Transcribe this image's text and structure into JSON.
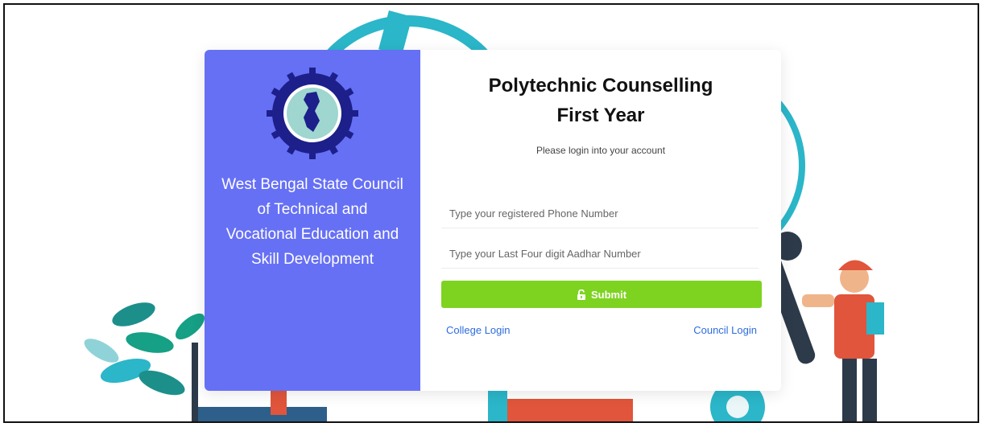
{
  "brand": {
    "council_name": "West Bengal State Council of Technical and Vocational Education and Skill Development"
  },
  "login": {
    "title_line1": "Polytechnic Counselling",
    "title_line2": "First Year",
    "subtitle": "Please login into your account",
    "phone_placeholder": "Type your registered Phone Number",
    "aadhar_placeholder": "Type your Last Four digit Aadhar Number",
    "submit_label": "Submit",
    "submit_icon": "unlock-icon",
    "college_link": "College Login",
    "council_link": "Council Login"
  },
  "colors": {
    "panel_blue": "#6670f5",
    "submit_green": "#7ed321",
    "link_blue": "#2d6cdf",
    "illustration_teal": "#2bb6c9"
  }
}
